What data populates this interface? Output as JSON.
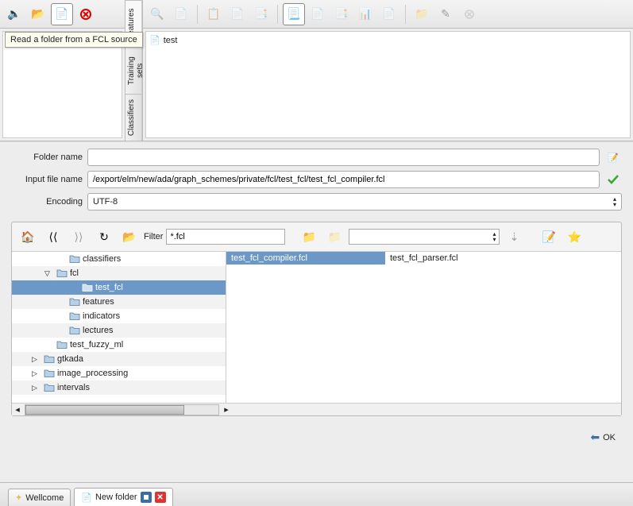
{
  "tooltip": "Read a folder from a FCL source",
  "sideTabs": [
    "Features",
    "Training sets",
    "Classifiers"
  ],
  "testItem": "test",
  "form": {
    "folderLabel": "Folder name",
    "folderValue": "",
    "inputLabel": "Input file name",
    "inputValue": "/export/elm/new/ada/graph_schemes/private/fcl/test_fcl/test_fcl_compiler.fcl",
    "encodingLabel": "Encoding",
    "encodingValue": "UTF-8"
  },
  "browser": {
    "filterLabel": "Filter",
    "filterValue": "*.fcl",
    "tree": [
      {
        "indent": 3,
        "label": "classifiers",
        "exp": "",
        "sel": false,
        "alt": false
      },
      {
        "indent": 2,
        "label": "fcl",
        "exp": "▽",
        "sel": false,
        "alt": true
      },
      {
        "indent": 4,
        "label": "test_fcl",
        "exp": "",
        "sel": true,
        "alt": false
      },
      {
        "indent": 3,
        "label": "features",
        "exp": "",
        "sel": false,
        "alt": true
      },
      {
        "indent": 3,
        "label": "indicators",
        "exp": "",
        "sel": false,
        "alt": false
      },
      {
        "indent": 3,
        "label": "lectures",
        "exp": "",
        "sel": false,
        "alt": true
      },
      {
        "indent": 2,
        "label": "test_fuzzy_ml",
        "exp": "",
        "sel": false,
        "alt": false
      },
      {
        "indent": 1,
        "label": "gtkada",
        "exp": "▷",
        "sel": false,
        "alt": true
      },
      {
        "indent": 1,
        "label": "image_processing",
        "exp": "▷",
        "sel": false,
        "alt": false
      },
      {
        "indent": 1,
        "label": "intervals",
        "exp": "▷",
        "sel": false,
        "alt": true
      }
    ],
    "files": [
      {
        "name": "test_fcl_compiler.fcl",
        "sel": true
      },
      {
        "name": "test_fcl_parser.fcl",
        "sel": false
      }
    ]
  },
  "okLabel": "OK",
  "bottomTabs": [
    {
      "label": "Wellcome",
      "icon": "star",
      "active": false,
      "closable": false
    },
    {
      "label": "New folder",
      "icon": "doc",
      "active": true,
      "closable": true
    }
  ]
}
